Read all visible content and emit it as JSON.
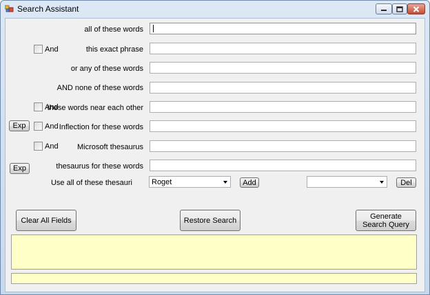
{
  "window": {
    "title": "Search Assistant"
  },
  "rows": {
    "all_words": {
      "label": "all of these words",
      "value": ""
    },
    "exact_phrase": {
      "label": "this exact phrase",
      "value": "",
      "and_label": "And"
    },
    "any_words": {
      "label": "or any of these words",
      "value": ""
    },
    "none_words": {
      "label": "AND none of these words",
      "value": ""
    },
    "near_words": {
      "label": "these words near each other",
      "value": "",
      "and_label": "And"
    },
    "inflection": {
      "label": "Inflection for these words",
      "value": "",
      "and_label": "And",
      "exp_label": "Exp"
    },
    "ms_thesaurus": {
      "label": "Microsoft thesaurus",
      "value": "",
      "and_label": "And"
    },
    "thesaurus_words": {
      "label": "thesaurus for these words",
      "value": "",
      "exp_label": "Exp"
    }
  },
  "thesauri": {
    "label": "Use all of these thesauri",
    "selected": "Roget",
    "add_label": "Add",
    "second_selected": "",
    "del_label": "Del"
  },
  "buttons": {
    "clear": "Clear All Fields",
    "restore": "Restore Search",
    "generate": "Generate Search Query"
  },
  "output": {
    "query": "",
    "status": ""
  }
}
